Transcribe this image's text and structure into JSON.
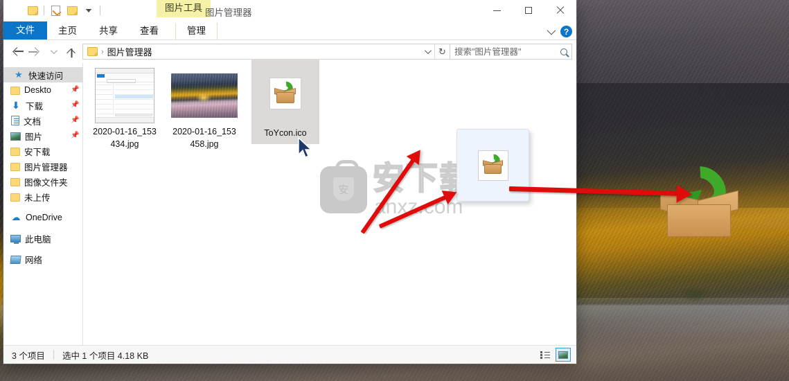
{
  "window": {
    "title": "图片管理器",
    "contextual_tool_label": "图片工具",
    "quick_access": [
      {
        "name": "folder-icon",
        "label": ""
      },
      {
        "name": "properties-icon",
        "label": ""
      },
      {
        "name": "new-folder-icon",
        "label": ""
      },
      {
        "name": "customize-chevron-icon",
        "label": ""
      }
    ],
    "controls": {
      "minimize": "最小化",
      "maximize": "最大化",
      "close": "关闭",
      "collapse_ribbon": "折叠功能区",
      "help": "?"
    }
  },
  "ribbon": {
    "tabs": [
      {
        "label": "文件",
        "active": false,
        "style": "file"
      },
      {
        "label": "主页",
        "active": false,
        "style": "normal"
      },
      {
        "label": "共享",
        "active": false,
        "style": "normal"
      },
      {
        "label": "查看",
        "active": false,
        "style": "normal"
      },
      {
        "label": "管理",
        "active": true,
        "style": "contextual"
      }
    ]
  },
  "address_bar": {
    "back_label": "后退",
    "forward_label": "前进",
    "recent_label": "最近浏览的位置",
    "up_label": "上移一级",
    "crumb_icon": "folder-icon",
    "crumb_separator": "›",
    "path": "图片管理器",
    "dropdown_label": "以前的位置",
    "refresh_label": "刷新",
    "refresh_glyph": "↻"
  },
  "search": {
    "placeholder": "搜索\"图片管理器\"",
    "value": "",
    "icon": "search-icon"
  },
  "sidebar": {
    "items": [
      {
        "label": "快速访问",
        "icon": "star-pin-icon",
        "kind": "head",
        "pinned": false,
        "selected": false
      },
      {
        "label": "Deskto",
        "icon": "folder-icon",
        "kind": "item",
        "pinned": true,
        "selected": false
      },
      {
        "label": "下载",
        "icon": "download-icon",
        "kind": "item",
        "pinned": true,
        "selected": false
      },
      {
        "label": "文档",
        "icon": "document-icon",
        "kind": "item",
        "pinned": true,
        "selected": false
      },
      {
        "label": "图片",
        "icon": "picture-icon",
        "kind": "item",
        "pinned": true,
        "selected": false
      },
      {
        "label": "安下载",
        "icon": "folder-icon",
        "kind": "item",
        "pinned": false,
        "selected": false
      },
      {
        "label": "图片管理器",
        "icon": "folder-icon",
        "kind": "item",
        "pinned": false,
        "selected": false
      },
      {
        "label": "图像文件夹",
        "icon": "folder-icon",
        "kind": "item",
        "pinned": false,
        "selected": false
      },
      {
        "label": "未上传",
        "icon": "folder-icon",
        "kind": "item",
        "pinned": false,
        "selected": false
      },
      {
        "label": "OneDrive",
        "icon": "cloud-icon",
        "kind": "group",
        "pinned": false,
        "selected": false
      },
      {
        "label": "此电脑",
        "icon": "this-pc-icon",
        "kind": "group",
        "pinned": false,
        "selected": false
      },
      {
        "label": "网络",
        "icon": "network-icon",
        "kind": "group",
        "pinned": false,
        "selected": false
      }
    ],
    "pin_glyph": "📌"
  },
  "files": [
    {
      "name": "2020-01-16_153434.jpg",
      "line1": "2020-01-16_153",
      "line2": "434.jpg",
      "thumb": "explorer-screenshot",
      "selected": false
    },
    {
      "name": "2020-01-16_153458.jpg",
      "line1": "2020-01-16_153",
      "line2": "458.jpg",
      "thumb": "landscape-photo",
      "selected": false
    },
    {
      "name": "ToYcon.ico",
      "line1": "ToYcon.ico",
      "line2": "",
      "thumb": "toycon-box-icon",
      "selected": true
    }
  ],
  "status_bar": {
    "item_count": "3 个项目",
    "selection": "选中 1 个项目  4.18 KB",
    "views": [
      {
        "name": "details-view-button",
        "label": "详细信息",
        "active": false
      },
      {
        "name": "large-icons-view-button",
        "label": "大图标",
        "active": true
      }
    ]
  },
  "desktop": {
    "drag_card": {
      "icon": "toycon-box-icon",
      "label": ""
    },
    "app_icon": {
      "name": "toycon-box-icon",
      "label": ""
    },
    "annotations": [
      {
        "name": "red-arrow-to-file",
        "label": ""
      },
      {
        "name": "red-arrow-to-card",
        "label": ""
      },
      {
        "name": "red-arrow-to-app-icon",
        "label": ""
      }
    ]
  },
  "watermark": {
    "cn": "安下载",
    "en": "anxz.com",
    "badge": "安"
  },
  "colors": {
    "accent_blue": "#0b75c9",
    "file_tab_blue": "#0b75c9",
    "contextual_yellow": "#f5f2a8",
    "selection_blue": "#ddeefc",
    "selected_tile_gray": "#ddd9d9",
    "annotation_red": "#e00b0b",
    "box_orange": "#d79f5e",
    "arrow_green": "#3faa2a"
  }
}
